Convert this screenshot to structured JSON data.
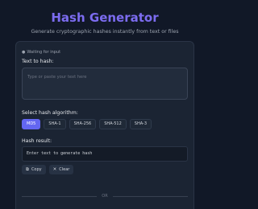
{
  "header": {
    "title": "Hash Generator",
    "subtitle": "Generate cryptographic hashes instantly from text or files"
  },
  "status": {
    "icon": "dot-icon",
    "text": "Waiting for input"
  },
  "input": {
    "label": "Text to hash:",
    "placeholder": "Type or paste your text here"
  },
  "algorithm": {
    "label": "Select hash algorithm:",
    "options": [
      "MD5",
      "SHA-1",
      "SHA-256",
      "SHA-512",
      "SHA-3"
    ],
    "selected": "MD5"
  },
  "result": {
    "label": "Hash result:",
    "value": "Enter text to generate hash"
  },
  "actions": {
    "copy_label": "Copy",
    "clear_label": "Clear"
  },
  "divider": {
    "text": "OR"
  },
  "colors": {
    "accent": "#6366f1",
    "title": "#7c6cf0",
    "background": "#111827",
    "card": "#1b2433"
  }
}
